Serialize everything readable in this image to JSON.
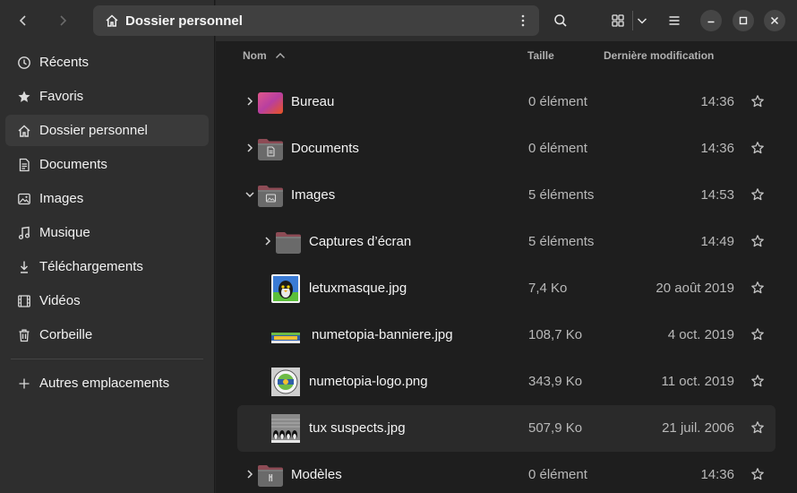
{
  "header": {
    "title": "Dossier personnel"
  },
  "sidebar": {
    "items": [
      {
        "label": "Récents",
        "icon": "clock-icon"
      },
      {
        "label": "Favoris",
        "icon": "star-icon"
      },
      {
        "label": "Dossier personnel",
        "icon": "home-icon",
        "active": true
      },
      {
        "label": "Documents",
        "icon": "document-icon"
      },
      {
        "label": "Images",
        "icon": "image-icon"
      },
      {
        "label": "Musique",
        "icon": "music-icon"
      },
      {
        "label": "Téléchargements",
        "icon": "download-icon"
      },
      {
        "label": "Vidéos",
        "icon": "video-icon"
      },
      {
        "label": "Corbeille",
        "icon": "trash-icon"
      }
    ],
    "other_locations": "Autres emplacements"
  },
  "columns": {
    "name": "Nom",
    "size": "Taille",
    "modified": "Dernière modification"
  },
  "files": [
    {
      "name": "Bureau",
      "size": "0 élément",
      "modified": "14:36",
      "kind": "desktop-folder",
      "depth": 0,
      "expander": "collapsed"
    },
    {
      "name": "Documents",
      "size": "0 élément",
      "modified": "14:36",
      "kind": "documents-folder",
      "depth": 0,
      "expander": "collapsed"
    },
    {
      "name": "Images",
      "size": "5 éléments",
      "modified": "14:53",
      "kind": "pictures-folder",
      "depth": 0,
      "expander": "expanded"
    },
    {
      "name": "Captures d’écran",
      "size": "5 éléments",
      "modified": "14:49",
      "kind": "folder",
      "depth": 1,
      "expander": "collapsed"
    },
    {
      "name": "letuxmasque.jpg",
      "size": "7,4 Ko",
      "modified": "20 août 2019",
      "kind": "image",
      "depth": 1
    },
    {
      "name": "numetopia-banniere.jpg",
      "size": "108,7 Ko",
      "modified": "4 oct. 2019",
      "kind": "banner",
      "depth": 1
    },
    {
      "name": "numetopia-logo.png",
      "size": "343,9 Ko",
      "modified": "11 oct. 2019",
      "kind": "image",
      "depth": 1
    },
    {
      "name": "tux suspects.jpg",
      "size": "507,9 Ko",
      "modified": "21 juil. 2006",
      "kind": "image",
      "depth": 1
    },
    {
      "name": "Modèles",
      "size": "0 élément",
      "modified": "14:36",
      "kind": "templates-folder",
      "depth": 0,
      "expander": "collapsed"
    }
  ],
  "colors": {
    "accent": "#e95420",
    "folder": "#6f6f6f"
  }
}
